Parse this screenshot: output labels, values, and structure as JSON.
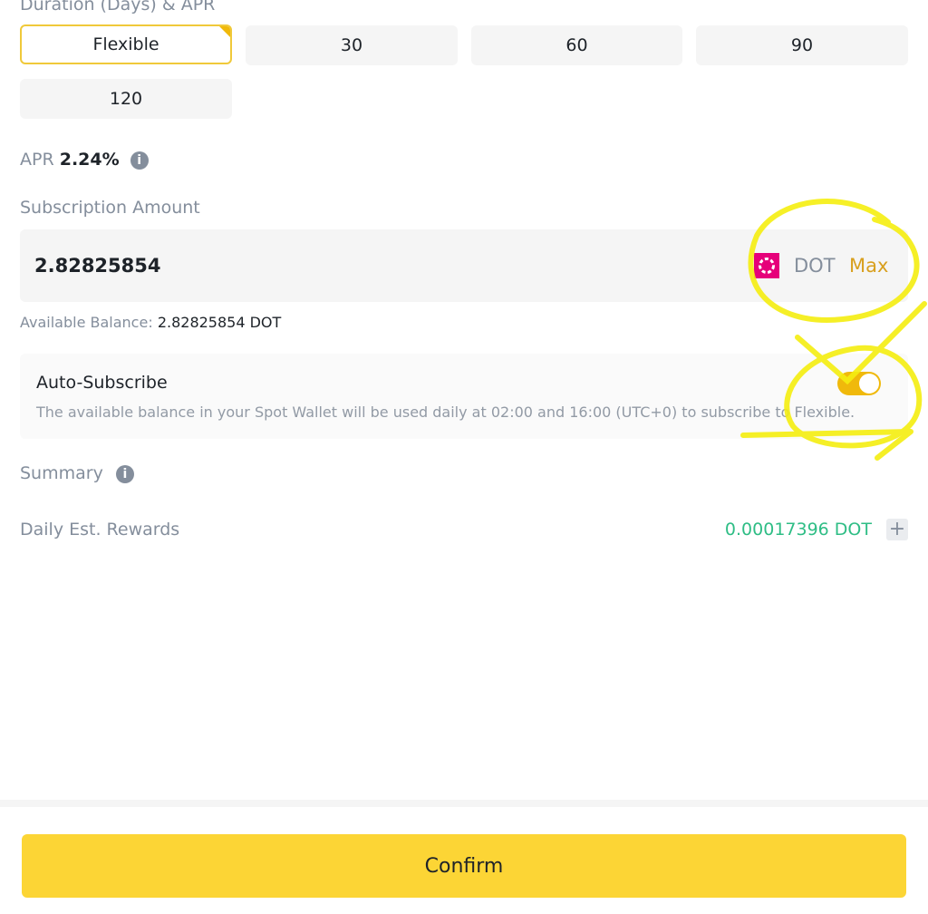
{
  "duration": {
    "heading": "Duration (Days) & APR",
    "options": [
      "Flexible",
      "30",
      "60",
      "90",
      "120"
    ],
    "selected": "Flexible"
  },
  "apr": {
    "label": "APR",
    "value": "2.24%"
  },
  "subscription": {
    "label": "Subscription Amount",
    "value": "2.82825854",
    "coin": "DOT",
    "max_label": "Max",
    "coin_color": "#e6007a"
  },
  "balance": {
    "label": "Available Balance:",
    "value": "2.82825854",
    "unit": "DOT"
  },
  "auto_subscribe": {
    "title": "Auto-Subscribe",
    "description": "The available balance in your Spot Wallet will be used daily at 02:00 and 16:00 (UTC+0) to subscribe to Flexible.",
    "enabled": true
  },
  "summary": {
    "label": "Summary",
    "daily_rewards_label": "Daily Est. Rewards",
    "daily_rewards_value": "0.00017396 DOT"
  },
  "confirm_label": "Confirm",
  "colors": {
    "accent": "#fcd535",
    "positive": "#2ebd85",
    "max": "#d89f1d",
    "annotation": "#f5ee10"
  }
}
